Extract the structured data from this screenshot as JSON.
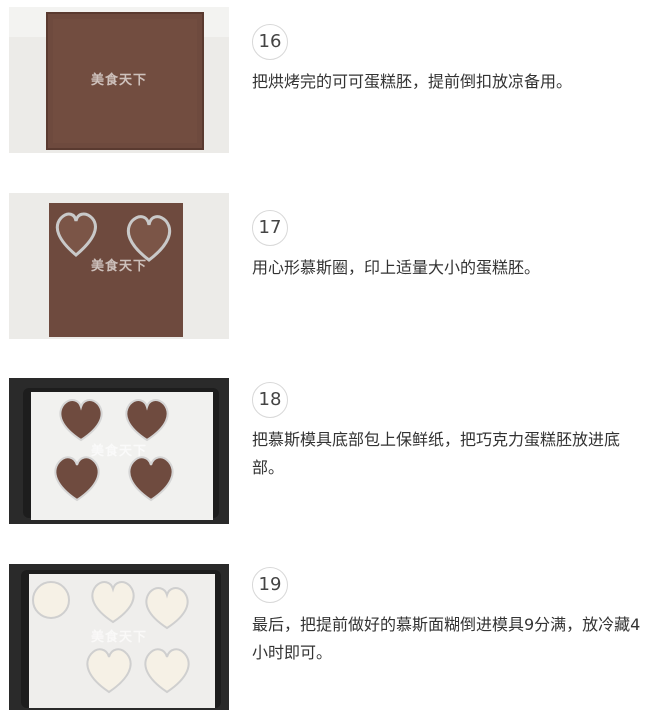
{
  "watermark": "美食天下",
  "steps": [
    {
      "number": "16",
      "text": "把烘烤完的可可蛋糕胚，提前倒扣放凉备用。"
    },
    {
      "number": "17",
      "text": "用心形慕斯圈，印上适量大小的蛋糕胚。"
    },
    {
      "number": "18",
      "text": "把慕斯模具底部包上保鲜纸，把巧克力蛋糕胚放进底部。"
    },
    {
      "number": "19",
      "text": "最后，把提前做好的慕斯面糊倒进模具9分满，放冷藏4小时即可。"
    }
  ]
}
